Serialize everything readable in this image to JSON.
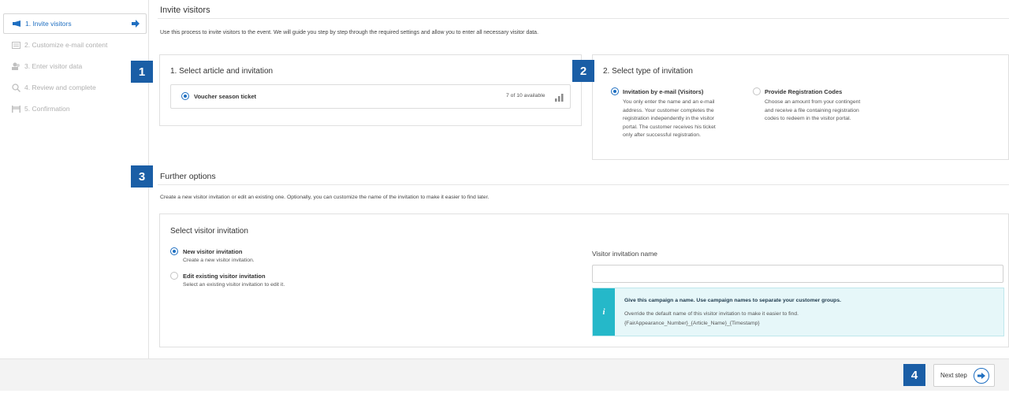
{
  "sidebar": {
    "steps": [
      {
        "label": "1. Invite visitors",
        "icon": "megaphone-icon",
        "active": true
      },
      {
        "label": "2. Customize e-mail content",
        "icon": "email-icon",
        "active": false
      },
      {
        "label": "3. Enter visitor data",
        "icon": "users-icon",
        "active": false
      },
      {
        "label": "4. Review and complete",
        "icon": "search-icon",
        "active": false
      },
      {
        "label": "5. Confirmation",
        "icon": "flag-icon",
        "active": false
      }
    ]
  },
  "main": {
    "title": "Invite visitors",
    "description": "Use this process to invite visitors to the event. We will guide you step by step through the required settings and allow you to enter all necessary visitor data.",
    "article_panel": {
      "title": "1. Select article and invitation",
      "item_label": "Voucher season ticket",
      "availability": "7 of 10 available"
    },
    "type_panel": {
      "title": "2. Select type of invitation",
      "option1_title": "Invitation by e-mail (Visitors)",
      "option1_desc_lines": [
        "You only enter the name and an e-mail",
        "address. Your customer completes the",
        "registration independently in the visitor",
        "portal. The customer receives his ticket",
        "only after successful registration."
      ],
      "option2_title": "Provide Registration Codes",
      "option2_desc_lines": [
        "Choose an amount from your contingent",
        "and receive a file containing registration",
        "codes to redeem in the visitor portal."
      ]
    },
    "further": {
      "title": "Further options",
      "description": "Create a new visitor invitation or edit an existing one. Optionally, you can customize the name of the invitation to make it easier to find later.",
      "panel_title": "Select visitor invitation",
      "new_title": "New visitor invitation",
      "new_desc": "Create a new visitor invitation.",
      "edit_title": "Edit existing visitor invitation",
      "edit_desc": "Select an existing visitor invitation to edit it.",
      "name_label": "Visitor invitation name",
      "name_value": "",
      "info_title": "Give this campaign a name. Use campaign names to separate your customer groups.",
      "info_line1": "Override the default name of this visitor invitation to make it easier to find.",
      "info_line2": "{FairAppearance_Number}_{Article_Name}_{Timestamp}",
      "info_icon": "i"
    }
  },
  "badges": [
    "1",
    "2",
    "3",
    "4"
  ],
  "footer": {
    "next_label": "Next step"
  },
  "colors": {
    "accent": "#1f6fc1",
    "badge": "#1a5ea6",
    "info": "#25b8c9"
  }
}
